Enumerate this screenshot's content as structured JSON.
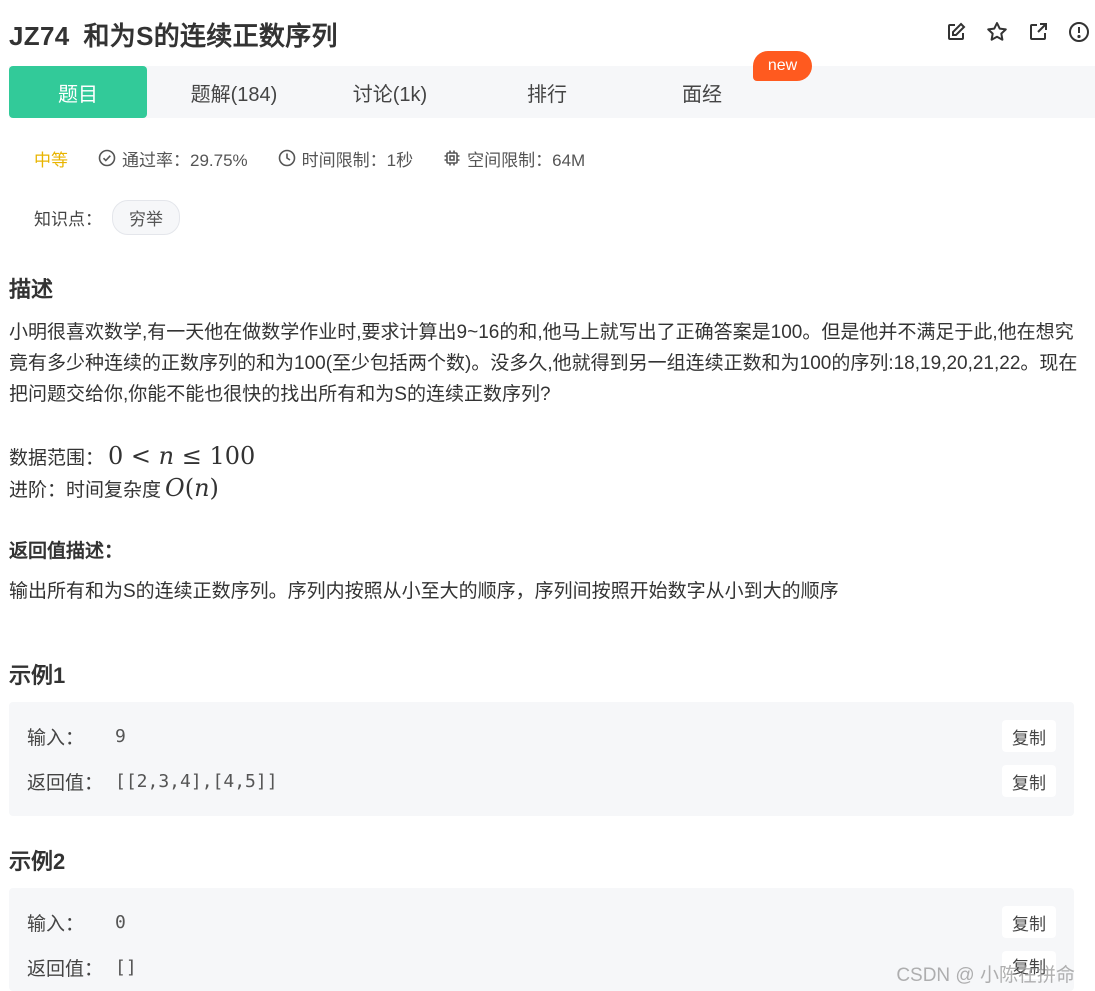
{
  "problem": {
    "code": "JZ74",
    "title": "和为S的连续正数序列"
  },
  "icons": [
    "edit-icon",
    "star-icon",
    "external-link-icon",
    "alert-icon"
  ],
  "tabs": [
    {
      "label": "题目",
      "active": true
    },
    {
      "label": "题解(184)",
      "active": false
    },
    {
      "label": "讨论(1k)",
      "active": false
    },
    {
      "label": "排行",
      "active": false
    },
    {
      "label": "面经",
      "active": false
    }
  ],
  "new_badge": "new",
  "meta": {
    "difficulty": "中等",
    "pass_rate": "通过率：29.75%",
    "time_limit": "时间限制：1秒",
    "space_limit": "空间限制：64M"
  },
  "knowledge": {
    "label": "知识点：",
    "tag": "穷举"
  },
  "description": {
    "heading": "描述",
    "text": "小明很喜欢数学,有一天他在做数学作业时,要求计算出9~16的和,他马上就写出了正确答案是100。但是他并不满足于此,他在想究竟有多少种连续的正数序列的和为100(至少包括两个数)。没多久,他就得到另一组连续正数和为100的序列:18,19,20,21,22。现在把问题交给你,你能不能也很快的找出所有和为S的连续正数序列?",
    "range_label": "数据范围：",
    "advanced_label": "进阶：时间复杂度"
  },
  "return": {
    "heading": "返回值描述：",
    "text": "输出所有和为S的连续正数序列。序列内按照从小至大的顺序，序列间按照开始数字从小到大的顺序"
  },
  "examples": [
    {
      "heading": "示例1",
      "input_label": "输入：",
      "input": "9",
      "output_label": "返回值：",
      "output": "[[2,3,4],[4,5]]",
      "copy": "复制"
    },
    {
      "heading": "示例2",
      "input_label": "输入：",
      "input": "0",
      "output_label": "返回值：",
      "output": "[]",
      "copy": "复制"
    }
  ],
  "watermark": "CSDN @   小陈在拼命",
  "colors": {
    "accent": "#32ca99",
    "difficulty": "#e8b400",
    "new_badge": "#ff5a1f"
  }
}
